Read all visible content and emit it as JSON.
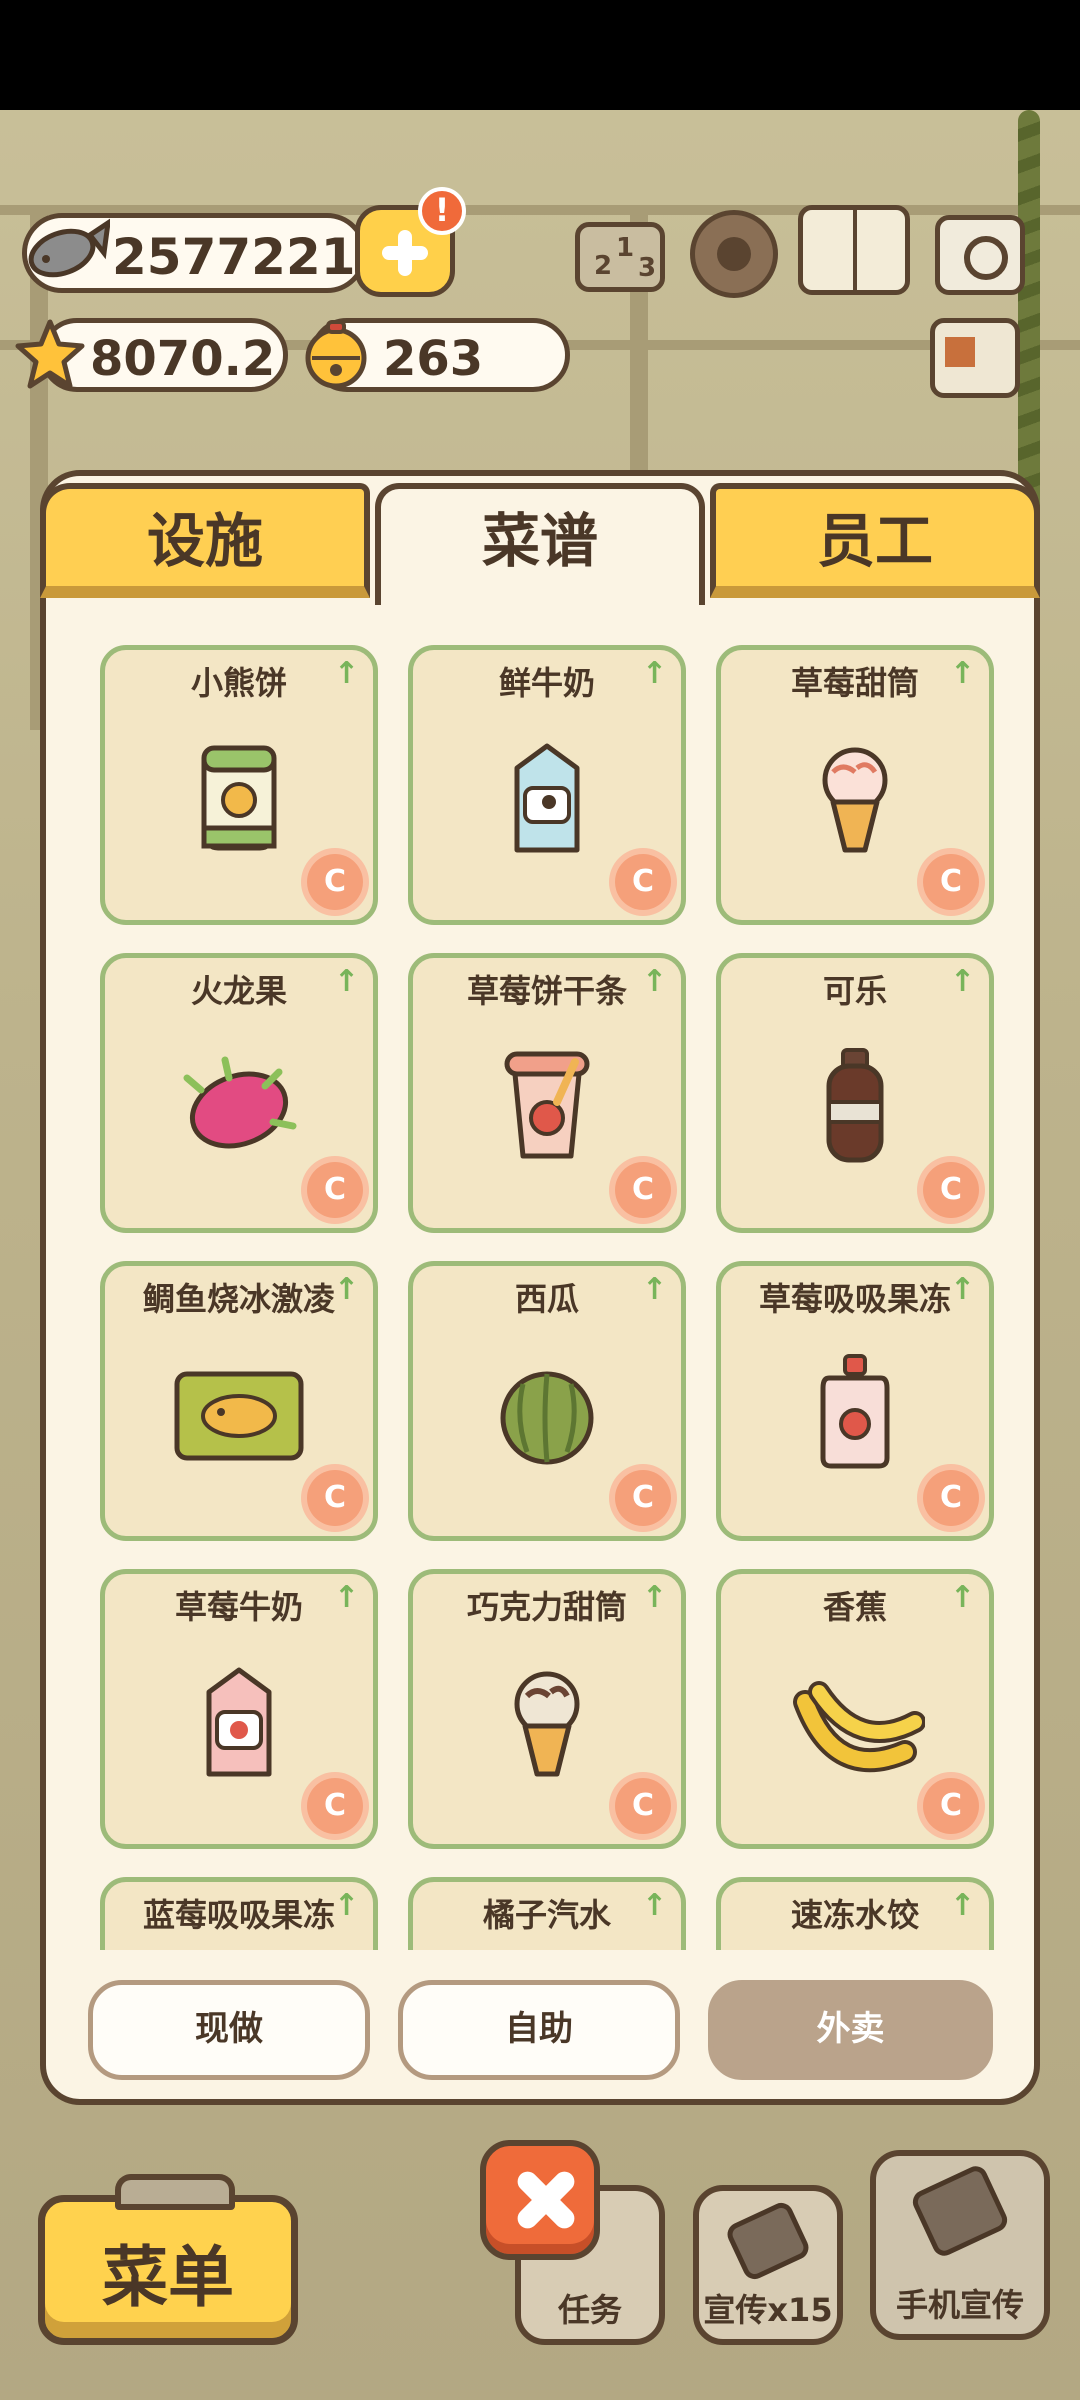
{
  "stats": {
    "fish": "2577221",
    "stars": "8070.2",
    "bells": "263",
    "alert_mark": "!"
  },
  "tabs": [
    {
      "label": "设施",
      "active": false
    },
    {
      "label": "菜谱",
      "active": true
    },
    {
      "label": "员工",
      "active": false
    }
  ],
  "recipes": [
    {
      "name": "小熊饼",
      "icon": "bear-cookie-can-icon"
    },
    {
      "name": "鲜牛奶",
      "icon": "milk-carton-icon"
    },
    {
      "name": "草莓甜筒",
      "icon": "strawberry-cone-icon"
    },
    {
      "name": "火龙果",
      "icon": "dragon-fruit-icon"
    },
    {
      "name": "草莓饼干条",
      "icon": "strawberry-stick-cup-icon"
    },
    {
      "name": "可乐",
      "icon": "cola-bottle-icon"
    },
    {
      "name": "鲷鱼烧冰激凌",
      "icon": "taiyaki-pack-icon"
    },
    {
      "name": "西瓜",
      "icon": "watermelon-icon"
    },
    {
      "name": "草莓吸吸果冻",
      "icon": "strawberry-jelly-pouch-icon"
    },
    {
      "name": "草莓牛奶",
      "icon": "strawberry-milk-carton-icon"
    },
    {
      "name": "巧克力甜筒",
      "icon": "chocolate-cone-icon"
    },
    {
      "name": "香蕉",
      "icon": "banana-icon"
    },
    {
      "name": "蓝莓吸吸果冻",
      "icon": "blueberry-jelly-icon"
    },
    {
      "name": "橘子汽水",
      "icon": "orange-soda-icon"
    },
    {
      "name": "速冻水饺",
      "icon": "frozen-dumplings-icon"
    }
  ],
  "coin_letter": "C",
  "upgrade_arrow": "↑",
  "modes": {
    "dine_in": "现做",
    "self_service": "自助",
    "takeout": "外卖"
  },
  "bottom": {
    "menu": "菜单",
    "tasks": "任务",
    "promo": "宣传x15",
    "phone_promo": "手机宣传"
  },
  "colors": {
    "tab_yellow": "#ffcf52",
    "card_bg": "#f3e6c5",
    "card_border": "#9dbb79",
    "outline": "#5a4430",
    "close_orange": "#ef6b3a"
  }
}
